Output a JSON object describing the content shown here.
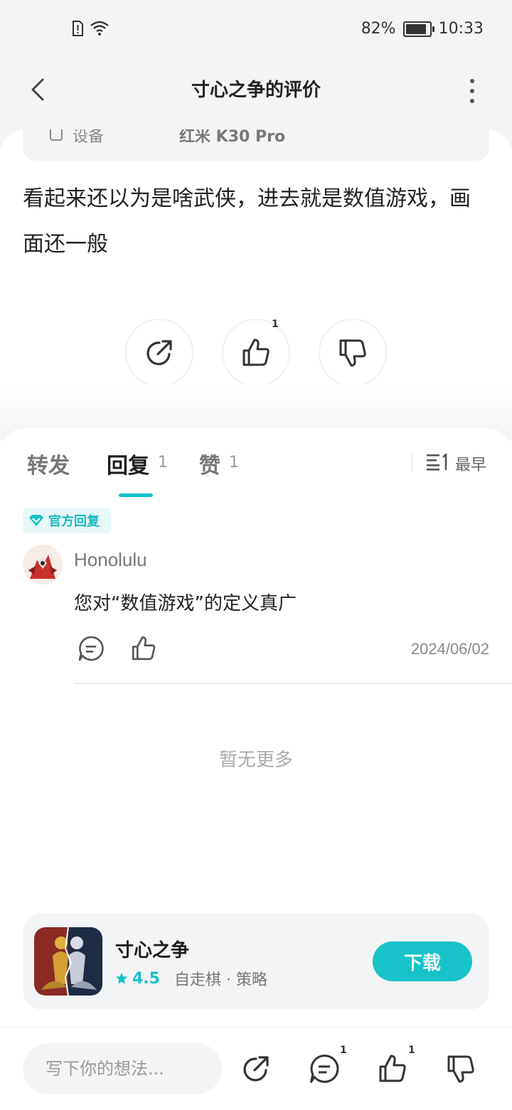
{
  "status_bar": {
    "battery": "82%",
    "time": "10:33"
  },
  "header": {
    "title": "寸心之争的评价"
  },
  "review": {
    "device_label": "设备",
    "device_value": "红米 K30 Pro",
    "text": "看起来还以为是啥武侠，进去就是数值游戏，画面还一般",
    "like_count": "1"
  },
  "tabs": {
    "items": [
      {
        "label": "转发",
        "count": ""
      },
      {
        "label": "回复",
        "count": "1"
      },
      {
        "label": "赞",
        "count": "1"
      }
    ],
    "sort_label": "最早"
  },
  "replies": [
    {
      "badge": "官方回复",
      "username": "Honolulu",
      "text": "您对“数值游戏”的定义真广",
      "date": "2024/06/02"
    }
  ],
  "no_more": "暂无更多",
  "app_card": {
    "name": "寸心之争",
    "rating": "4.5",
    "tags": "自走棋 · 策略",
    "download_label": "下载"
  },
  "bottom_bar": {
    "input_placeholder": "写下你的想法...",
    "comment_count": "1",
    "like_count": "1"
  },
  "colors": {
    "accent": "#17c3c8",
    "background": "#f3f4f6"
  }
}
